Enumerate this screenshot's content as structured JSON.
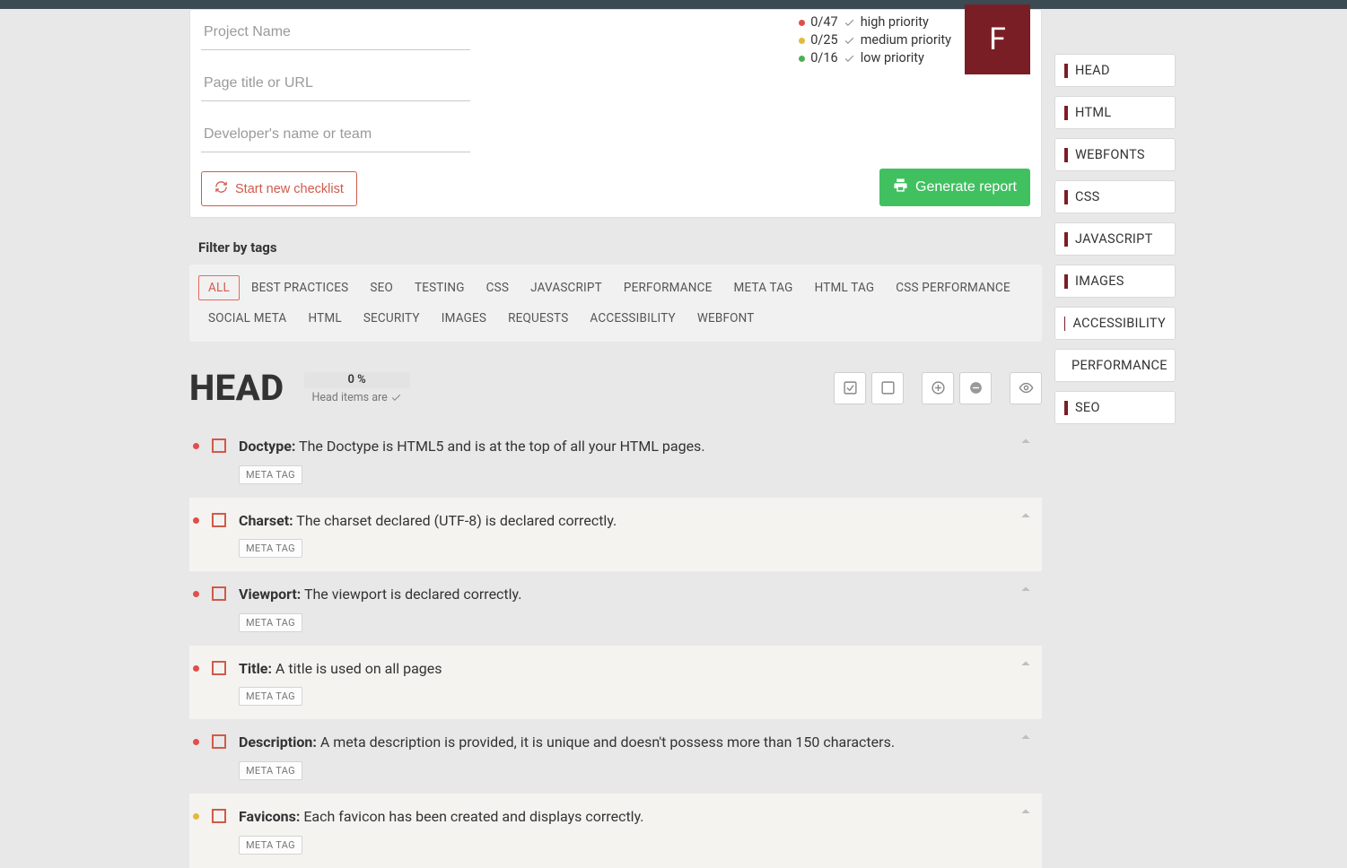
{
  "grade": "F",
  "inputs": {
    "project_ph": "Project Name",
    "page_ph": "Page title or URL",
    "dev_ph": "Developer's name or team"
  },
  "stats": {
    "high": {
      "count": "0/47",
      "label": "high priority"
    },
    "medium": {
      "count": "0/25",
      "label": "medium priority"
    },
    "low": {
      "count": "0/16",
      "label": "low priority"
    }
  },
  "buttons": {
    "start_new": "Start new checklist",
    "generate": "Generate report"
  },
  "filter": {
    "title": "Filter by tags",
    "tags": [
      "ALL",
      "BEST PRACTICES",
      "SEO",
      "TESTING",
      "CSS",
      "JAVASCRIPT",
      "PERFORMANCE",
      "META TAG",
      "HTML TAG",
      "CSS PERFORMANCE",
      "SOCIAL META",
      "HTML",
      "SECURITY",
      "IMAGES",
      "REQUESTS",
      "ACCESSIBILITY",
      "WEBFONT"
    ]
  },
  "section": {
    "title": "HEAD",
    "percent": "0 %",
    "sub": "Head items are"
  },
  "items": [
    {
      "priority": "high",
      "title": "Doctype:",
      "desc": "The Doctype is HTML5 and is at the top of all your HTML pages.",
      "tag": "META TAG"
    },
    {
      "priority": "high",
      "title": "Charset:",
      "desc": "The charset declared (UTF-8) is declared correctly.",
      "tag": "META TAG"
    },
    {
      "priority": "high",
      "title": "Viewport:",
      "desc": "The viewport is declared correctly.",
      "tag": "META TAG"
    },
    {
      "priority": "high",
      "title": "Title:",
      "desc": "A title is used on all pages",
      "tag": "META TAG"
    },
    {
      "priority": "high",
      "title": "Description:",
      "desc": "A meta description is provided, it is unique and doesn't possess more than 150 characters.",
      "tag": "META TAG"
    },
    {
      "priority": "med",
      "title": "Favicons:",
      "desc": "Each favicon has been created and displays correctly.",
      "tag": "META TAG"
    }
  ],
  "sidenav": [
    "HEAD",
    "HTML",
    "WEBFONTS",
    "CSS",
    "JAVASCRIPT",
    "IMAGES",
    "ACCESSIBILITY",
    "PERFORMANCE",
    "SEO"
  ]
}
